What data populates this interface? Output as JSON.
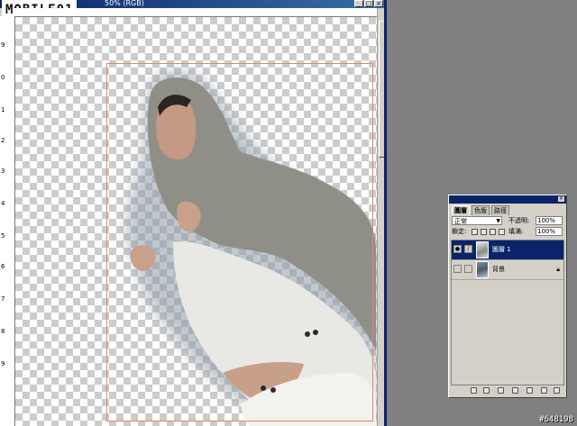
{
  "window": {
    "title": "50% (RGB)",
    "min_btn": "_",
    "max_btn": "□",
    "close_btn": "×"
  },
  "watermark": "MOBILE01",
  "vruler": {
    "ticks": [
      "9",
      "0",
      "1",
      "2",
      "3",
      "4",
      "5",
      "6",
      "7",
      "8",
      "9"
    ]
  },
  "layers_palette": {
    "tabs": [
      "圖層",
      "色版",
      "路徑"
    ],
    "blend_mode": "正常",
    "opacity_label": "不透明:",
    "opacity_value": "100%",
    "lock_label": "鎖定:",
    "fill_label": "填滿:",
    "fill_value": "100%",
    "layers": [
      {
        "name": "圖層 1",
        "selected": true,
        "visible": true
      },
      {
        "name": "背景",
        "selected": false,
        "visible": false,
        "locked": true
      }
    ]
  },
  "picture_id": "#648198",
  "colors": {
    "title_bar": "#0a246a",
    "selection_border": "#e08a6a",
    "workspace": "#808080"
  }
}
